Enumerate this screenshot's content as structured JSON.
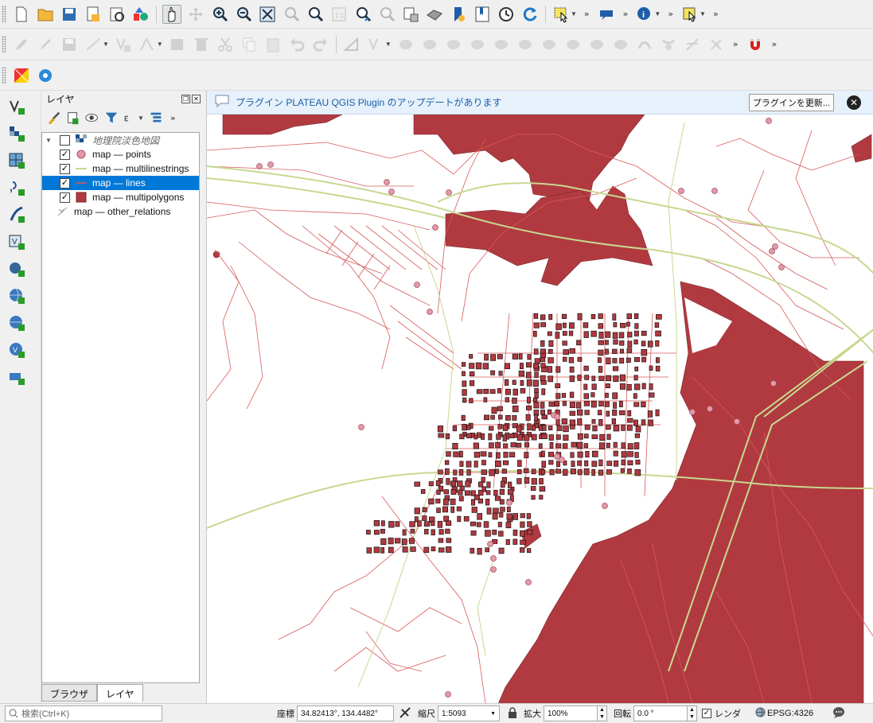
{
  "toolbar_top": {
    "icons": [
      "new-project-icon",
      "open-project-icon",
      "save-project-icon",
      "new-print-layout-icon",
      "layout-manager-icon",
      "style-manager-icon",
      "pan-map-icon",
      "pan-to-selection-icon",
      "zoom-in-icon",
      "zoom-out-icon",
      "zoom-full-icon",
      "zoom-to-selection-icon",
      "zoom-to-layer-icon",
      "zoom-native-icon",
      "zoom-last-icon",
      "zoom-next-icon",
      "new-map-view-icon",
      "new-3d-view-icon",
      "bookmark-new-icon",
      "show-bookmarks-icon",
      "temporal-controller-icon",
      "refresh-icon",
      "select-features-icon",
      "annotation-icon",
      "identify-icon",
      "select-location-icon"
    ]
  },
  "toolbar_edit": {
    "icons": [
      "edit-pencil-icon",
      "toggle-editing-icon",
      "save-edits-icon",
      "digitize-icon",
      "add-feature-icon",
      "vertex-tool-icon",
      "modify-attributes-icon",
      "delete-selected-icon",
      "cut-features-icon",
      "copy-features-icon",
      "paste-features-icon",
      "undo-icon",
      "redo-icon",
      "advanced-digitize-icon",
      "snapping-icon"
    ]
  },
  "toolbar_plugins": {
    "icons": [
      "plateau-plugin-icon",
      "plugin-settings-icon"
    ]
  },
  "left_tools": {
    "icons": [
      "add-vector-layer-icon",
      "add-raster-layer-icon",
      "add-mesh-layer-icon",
      "add-delimited-text-icon",
      "add-spatialite-icon",
      "add-virtual-layer-icon",
      "add-postgis-icon",
      "add-wms-icon",
      "add-wfs-icon",
      "add-wcs-icon",
      "add-mssql-icon"
    ]
  },
  "layers_panel": {
    "title": "レイヤ",
    "tabs": [
      "ブラウザ",
      "レイヤ"
    ],
    "layers": [
      {
        "label": "地理院淡色地図",
        "checked": false,
        "italic": true
      },
      {
        "label": "map — points",
        "checked": true
      },
      {
        "label": "map — multilinestrings",
        "checked": true
      },
      {
        "label": "map — lines",
        "checked": true,
        "selected": true
      },
      {
        "label": "map — multipolygons",
        "checked": true
      },
      {
        "label": "map — other_relations",
        "checked": null
      }
    ]
  },
  "message_bar": {
    "text": "プラグイン PLATEAU QGIS Plugin のアップデートがあります",
    "update_button": "プラグインを更新...",
    "close": "✕"
  },
  "map": {
    "colors": {
      "polygon": "#b03a40",
      "polygon_stroke": "#7a2428",
      "line": "#d85a5a",
      "multiline": "#c8d890",
      "point_fill": "#e09aa6",
      "point_stroke": "#b0506a",
      "building_stroke": "#1a1010"
    }
  },
  "status_bar": {
    "search_placeholder": "検索(Ctrl+K)",
    "coordinate_label": "座標",
    "coordinate_value": "34.82413°, 134.4482°",
    "scale_label": "縮尺",
    "scale_value": "1:5093",
    "magnifier_label": "拡大",
    "magnifier_value": "100%",
    "rotation_label": "回転",
    "rotation_value": "0.0 °",
    "render_label": "レンダ",
    "render_checked": true,
    "crs": "EPSG:4326"
  }
}
